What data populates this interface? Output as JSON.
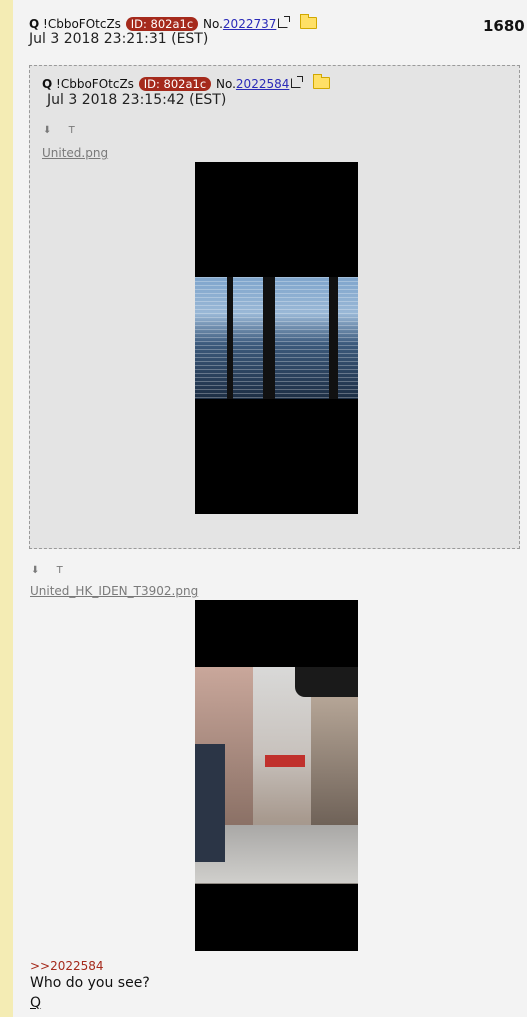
{
  "post": {
    "name": "Q",
    "tripcode": "!CbboFOtcZs",
    "id_badge": "ID: 802a1c",
    "no_prefix": "No.",
    "no_number": "2022737",
    "date": "Jul 3 2018 23:21:31 (EST)",
    "post_count": "1680",
    "file_tool_download": "⬇",
    "file_tool_text": "T",
    "filename": "United_HK_IDEN_T3902.png",
    "reply_ref": ">>2022584",
    "body": "Who do you see?",
    "signature": "Q"
  },
  "quoted": {
    "name": "Q",
    "tripcode": "!CbboFOtcZs",
    "id_badge": "ID: 802a1c",
    "no_prefix": "No.",
    "no_number": "2022584",
    "date": "Jul 3 2018 23:15:42 (EST)",
    "file_tool_download": "⬇",
    "file_tool_text": "T",
    "filename": "United.png"
  },
  "colors": {
    "accent_bar": "#f4ecb4",
    "id_badge": "#a52a1c",
    "link": "#2a2ab8",
    "reply_link": "#a52a1c"
  }
}
